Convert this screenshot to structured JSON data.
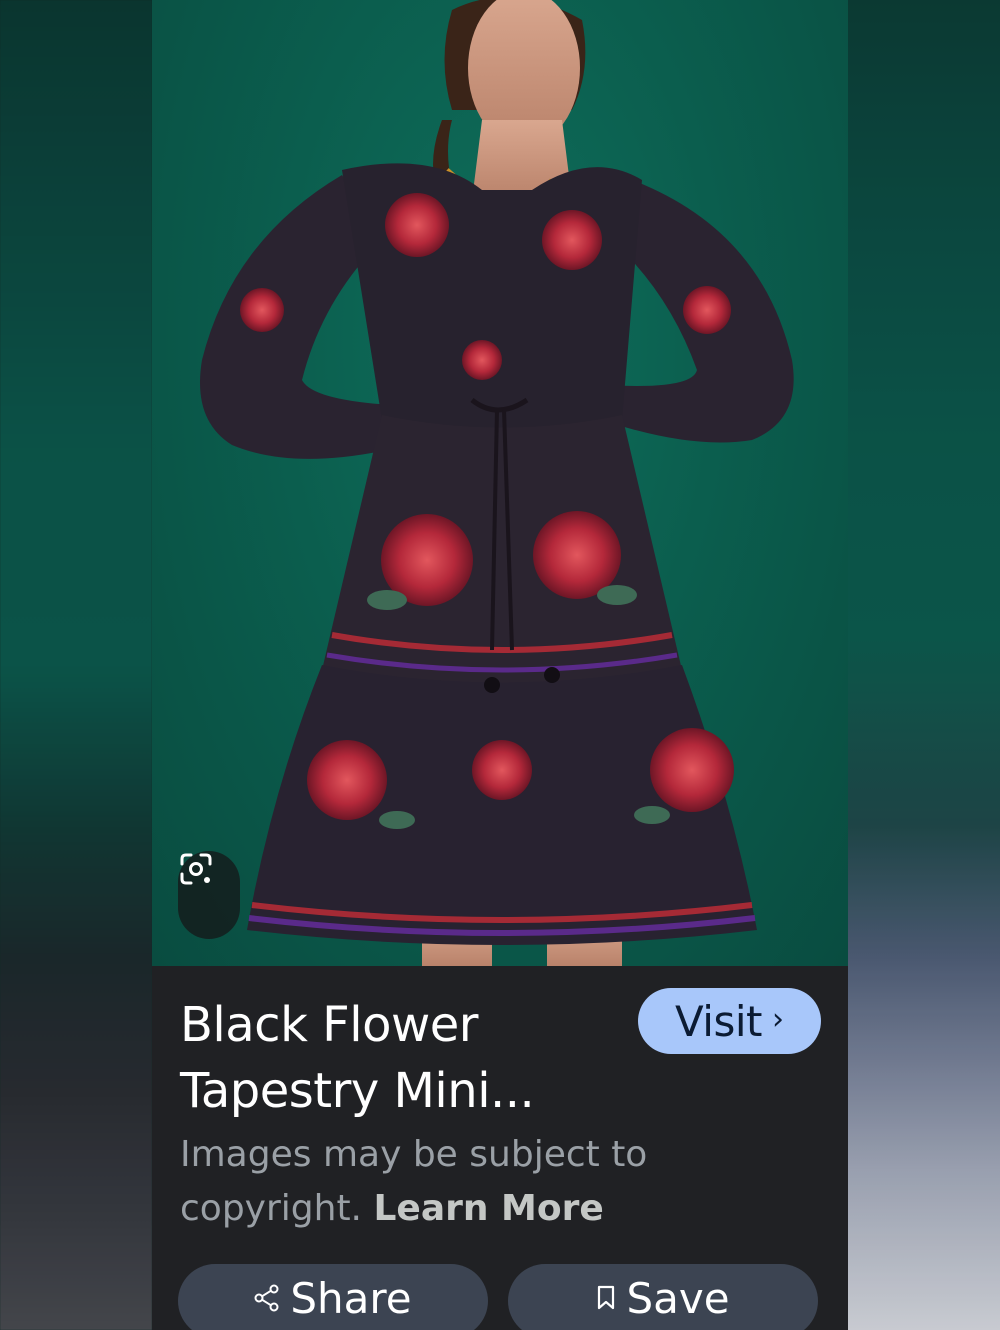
{
  "result": {
    "title": "Black Flower Tapestry Mini...",
    "visit_label": "Visit",
    "copyright_text": "Images may be subject to copyright.",
    "learn_more_label": "Learn More"
  },
  "actions": {
    "share_label": "Share",
    "save_label": "Save"
  },
  "icons": {
    "lens": "google-lens-icon",
    "share": "share-icon",
    "save": "bookmark-icon",
    "visit": "chevron-right-icon"
  },
  "colors": {
    "card_background": "#202124",
    "visit_button": "#a8c7fa",
    "pill_button": "#3c4452",
    "photo_background": "#0b5e4e"
  }
}
